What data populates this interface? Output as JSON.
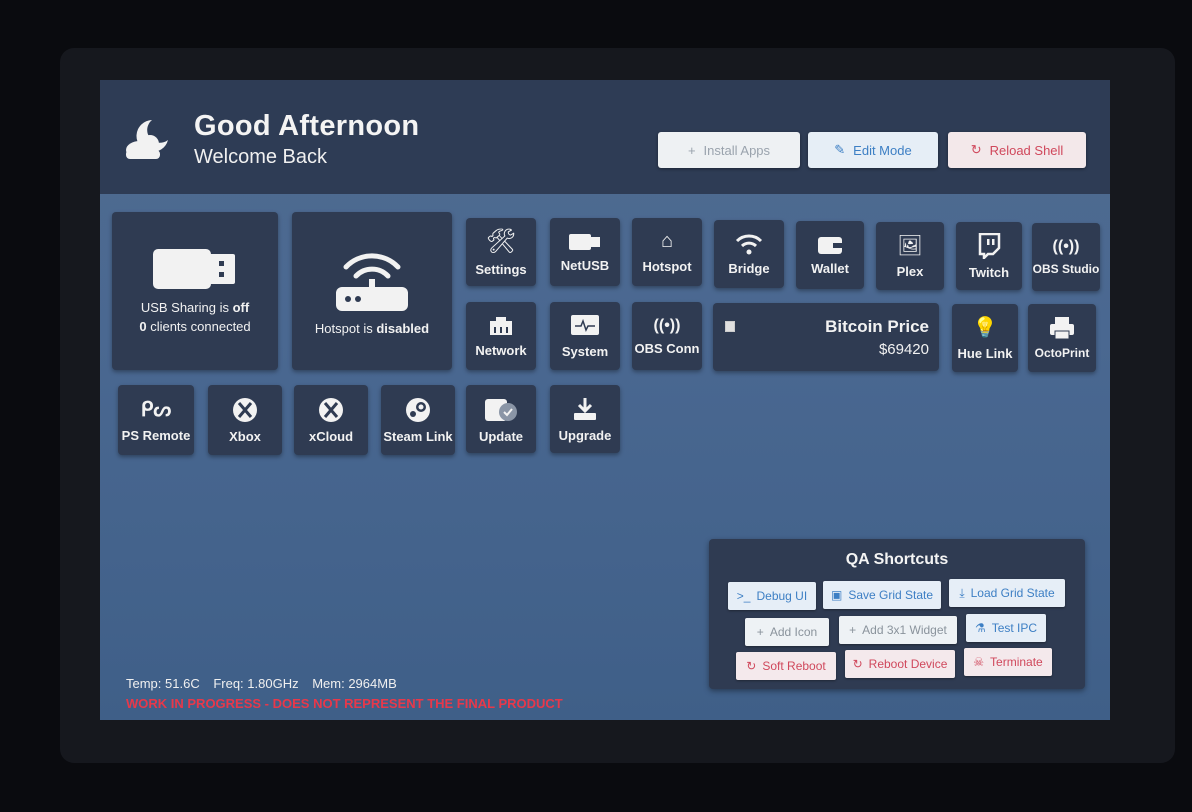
{
  "header": {
    "greeting": "Good Afternoon",
    "subtitle": "Welcome Back",
    "buttons": {
      "install": "Install Apps",
      "edit": "Edit Mode",
      "reload": "Reload Shell"
    }
  },
  "widgets": {
    "usb": {
      "line1_prefix": "USB Sharing is ",
      "line1_state": "off",
      "line2_count": "0",
      "line2_suffix": " clients connected"
    },
    "hotspot": {
      "prefix": "Hotspot is ",
      "state": "disabled"
    },
    "bitcoin": {
      "title": "Bitcoin Price",
      "value": "$69420"
    }
  },
  "apps": {
    "settings": "Settings",
    "netusb": "NetUSB",
    "hotspot": "Hotspot",
    "bridge": "Bridge",
    "wallet": "Wallet",
    "plex": "Plex",
    "twitch": "Twitch",
    "obs_studio": "OBS Studio",
    "network": "Network",
    "system": "System",
    "obs_conn": "OBS Conn",
    "hue_link": "Hue Link",
    "octoprint": "OctoPrint",
    "ps_remote": "PS Remote",
    "xbox": "Xbox",
    "xcloud": "xCloud",
    "steam_link": "Steam Link",
    "update": "Update",
    "upgrade": "Upgrade"
  },
  "qa": {
    "title": "QA Shortcuts",
    "debug_ui": "Debug UI",
    "save_grid": "Save Grid State",
    "load_grid": "Load Grid State",
    "add_icon": "Add Icon",
    "add_widget": "Add 3x1 Widget",
    "test_ipc": "Test IPC",
    "soft_reboot": "Soft Reboot",
    "reboot_device": "Reboot Device",
    "terminate": "Terminate"
  },
  "footer": {
    "temp": "Temp: 51.6C",
    "freq": "Freq: 1.80GHz",
    "mem": "Mem: 2964MB",
    "warning": "WORK IN PROGRESS - DOES NOT REPRESENT THE FINAL PRODUCT"
  },
  "colors": {
    "header_bg": "#2e3c55",
    "tile_bg": "#2f3b52",
    "screen_bg": "#4a6891",
    "warning": "#e8384a"
  }
}
